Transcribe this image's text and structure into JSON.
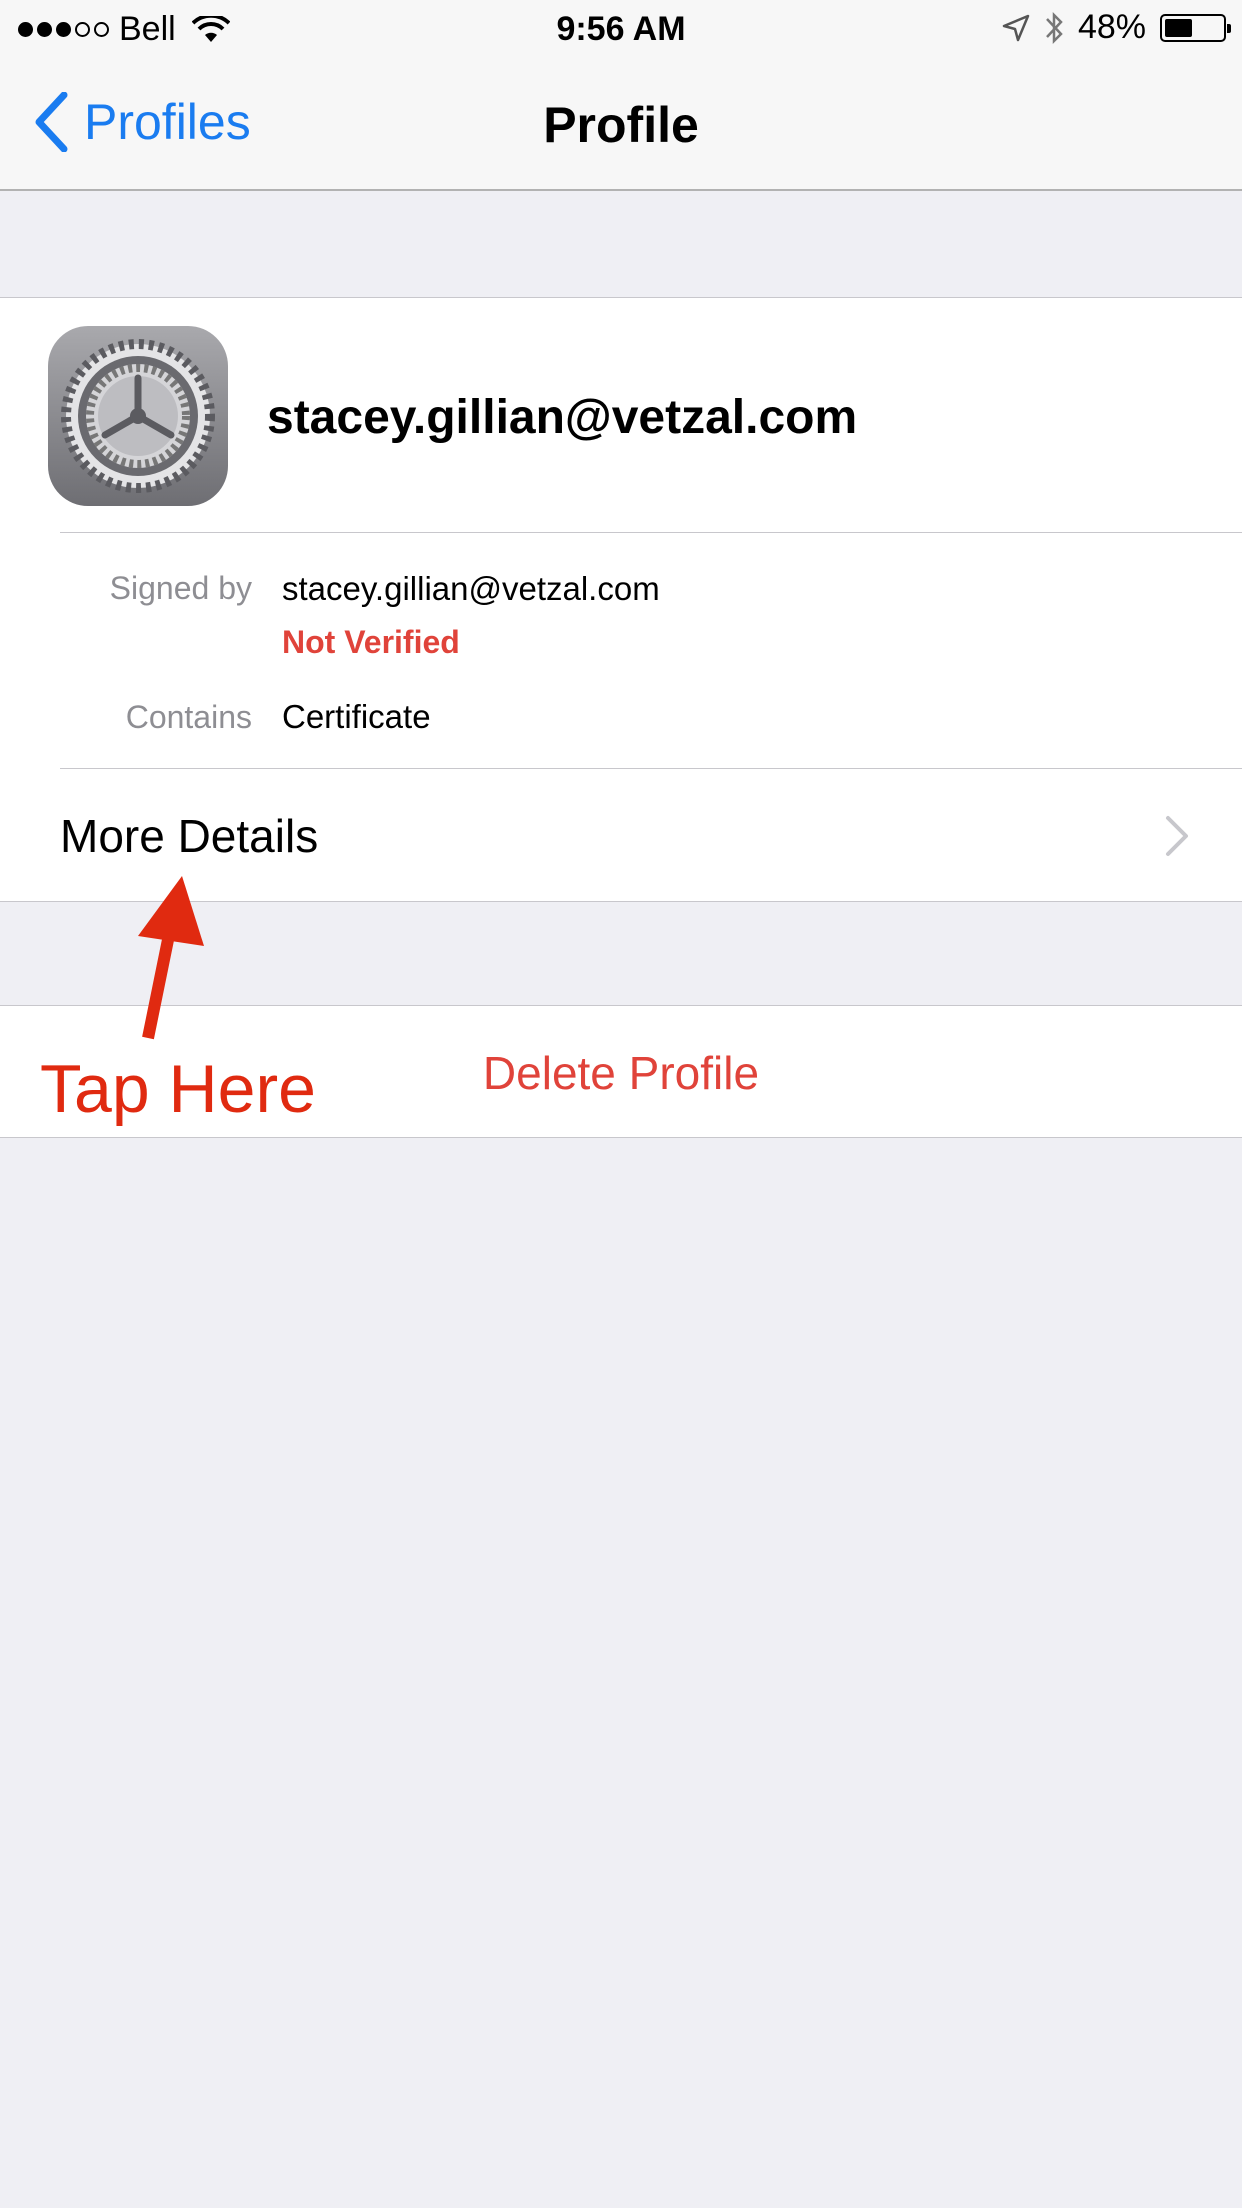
{
  "status_bar": {
    "carrier": "Bell",
    "time": "9:56 AM",
    "battery": "48%",
    "battery_level": 0.48,
    "signal_bars_filled": 3,
    "signal_bars_total": 5
  },
  "nav": {
    "back_label": "Profiles",
    "title": "Profile"
  },
  "profile": {
    "name": "stacey.gillian@vetzal.com",
    "icon": "settings-gear-icon",
    "signed_by_label": "Signed by",
    "signed_by_value": "stacey.gillian@vetzal.com",
    "verification_status": "Not Verified",
    "contains_label": "Contains",
    "contains_value": "Certificate",
    "more_details_label": "More Details"
  },
  "actions": {
    "delete_label": "Delete Profile"
  },
  "annotation": {
    "text": "Tap Here"
  },
  "colors": {
    "accent": "#1a7cf0",
    "destructive": "#e0433a",
    "annotation": "#e02a10",
    "background": "#efeff4"
  }
}
